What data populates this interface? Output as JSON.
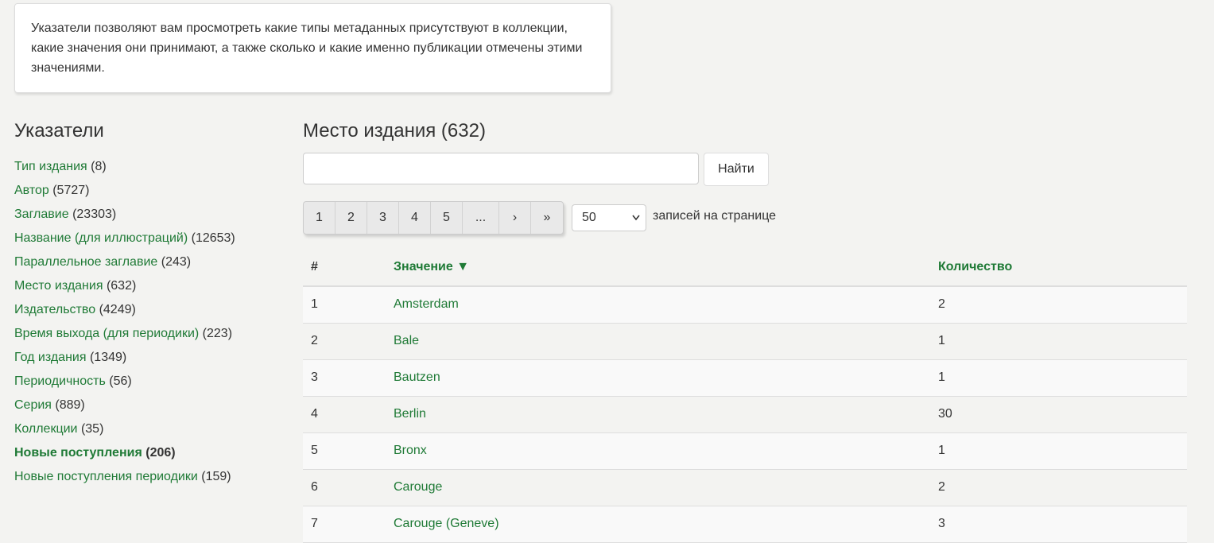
{
  "info": {
    "text": "Указатели позволяют вам просмотреть какие типы метаданных присутствуют в коллекции, какие значения они принимают, а также сколько и какие именно публикации отмечены этими значениями."
  },
  "sidebar": {
    "title": "Указатели",
    "items": [
      {
        "label": "Тип издания",
        "count": "(8)"
      },
      {
        "label": "Автор",
        "count": "(5727)"
      },
      {
        "label": "Заглавие",
        "count": "(23303)"
      },
      {
        "label": "Название (для иллюстраций)",
        "count": "(12653)"
      },
      {
        "label": "Параллельное заглавие",
        "count": "(243)"
      },
      {
        "label": "Место издания",
        "count": "(632)"
      },
      {
        "label": "Издательство",
        "count": "(4249)"
      },
      {
        "label": "Время выхода (для периодики)",
        "count": "(223)"
      },
      {
        "label": "Год издания",
        "count": "(1349)"
      },
      {
        "label": "Периодичность",
        "count": "(56)"
      },
      {
        "label": "Серия",
        "count": "(889)"
      },
      {
        "label": "Коллекции",
        "count": "(35)"
      },
      {
        "label": "Новые поступления",
        "count": "(206)"
      },
      {
        "label": "Новые поступления периодики",
        "count": "(159)"
      }
    ]
  },
  "main": {
    "title": "Место издания (632)",
    "search": {
      "value": "",
      "placeholder": "",
      "button_label": "Найти"
    },
    "pagination": [
      "1",
      "2",
      "3",
      "4",
      "5",
      "...",
      "›",
      "»"
    ],
    "per_page": {
      "selected": "50",
      "label": "записей на странице"
    },
    "table": {
      "headers": {
        "num": "#",
        "value": "Значение ▼",
        "count": "Количество"
      },
      "rows": [
        {
          "num": "1",
          "value": "Amsterdam",
          "count": "2"
        },
        {
          "num": "2",
          "value": "Bale",
          "count": "1"
        },
        {
          "num": "3",
          "value": "Bautzen",
          "count": "1"
        },
        {
          "num": "4",
          "value": "Berlin",
          "count": "30"
        },
        {
          "num": "5",
          "value": "Bronx",
          "count": "1"
        },
        {
          "num": "6",
          "value": "Carouge",
          "count": "2"
        },
        {
          "num": "7",
          "value": "Carouge (Geneve)",
          "count": "3"
        }
      ]
    }
  },
  "colors": {
    "link": "#1f7a36",
    "background": "#f3f3f1",
    "text": "#333333"
  }
}
